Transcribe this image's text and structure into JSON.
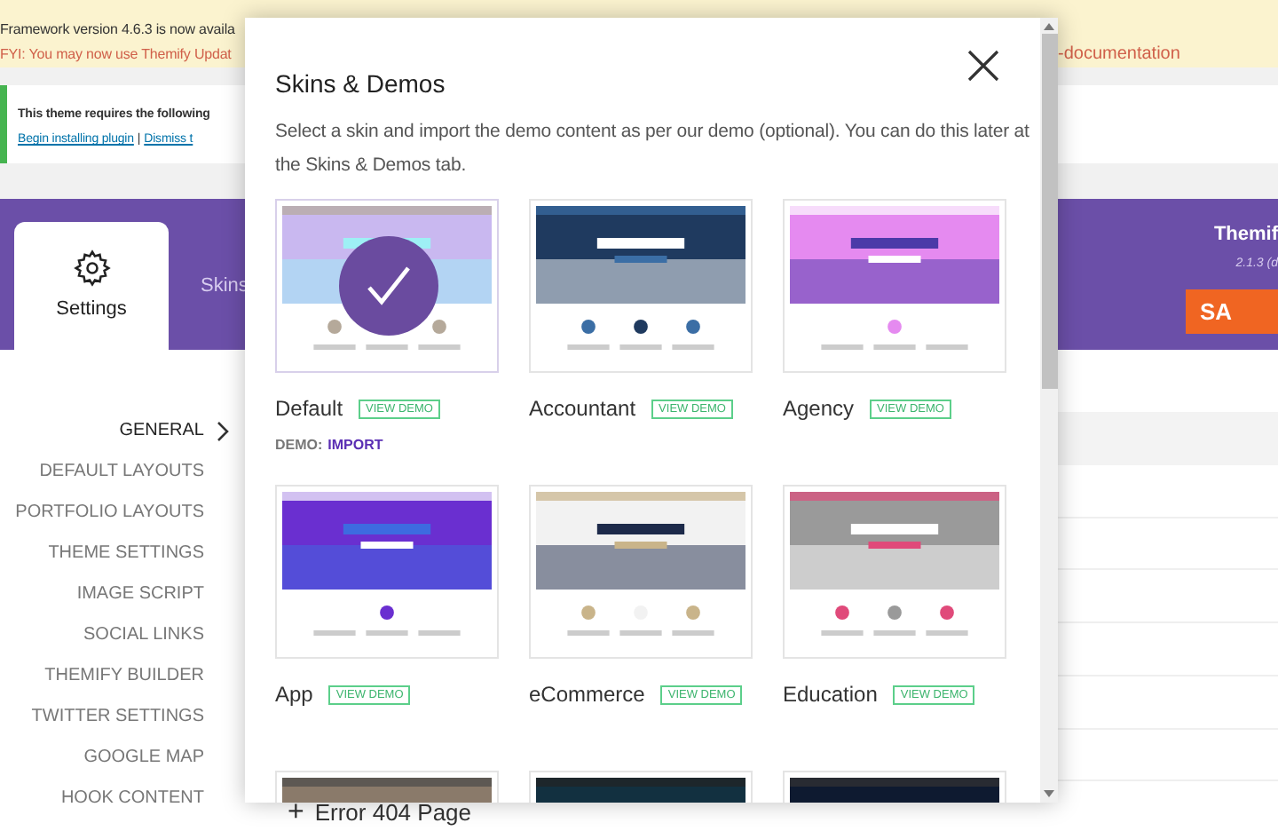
{
  "update_notice": {
    "line_1": "Framework version 4.6.3 is now availa",
    "line_2": "FYI: You may now use Themify Updat",
    "line_2_end": "-documentation"
  },
  "plugin_notice": {
    "text": "This theme requires the following",
    "link_1": "Begin installing plugin",
    "separator": "|",
    "link_2": "Dismiss t"
  },
  "header": {
    "tabs": [
      {
        "label": "Settings",
        "selected": true
      },
      {
        "label": "Skins",
        "selected": false
      }
    ],
    "product": "Themif",
    "version": "2.1.3 (d",
    "save_button": "SA"
  },
  "menu": [
    {
      "label": "GENERAL",
      "selected": true
    },
    {
      "label": "DEFAULT LAYOUTS",
      "selected": false
    },
    {
      "label": "PORTFOLIO LAYOUTS",
      "selected": false
    },
    {
      "label": "THEME SETTINGS",
      "selected": false
    },
    {
      "label": "IMAGE SCRIPT",
      "selected": false
    },
    {
      "label": "SOCIAL LINKS",
      "selected": false
    },
    {
      "label": "THEMIFY BUILDER",
      "selected": false
    },
    {
      "label": "TWITTER SETTINGS",
      "selected": false
    },
    {
      "label": "GOOGLE MAP",
      "selected": false
    },
    {
      "label": "HOOK CONTENT",
      "selected": false
    }
  ],
  "add_row": {
    "icon": "+",
    "label": "Error 404 Page"
  },
  "modal": {
    "title": "Skins & Demos",
    "description": "Select a skin and import the demo content as per our demo (optional). You can do this later at the Skins & Demos tab.",
    "skins": [
      {
        "name": "Default",
        "button": "VIEW DEMO",
        "selected": true,
        "demo_label": "DEMO:",
        "demo_action": "IMPORT"
      },
      {
        "name": "Accountant",
        "button": "VIEW DEMO",
        "selected": false
      },
      {
        "name": "Agency",
        "button": "VIEW DEMO",
        "selected": false
      },
      {
        "name": "App",
        "button": "VIEW DEMO",
        "selected": false
      },
      {
        "name": "eCommerce",
        "button": "VIEW DEMO",
        "selected": false
      },
      {
        "name": "Education",
        "button": "VIEW DEMO",
        "selected": false
      },
      {
        "selected": false
      },
      {
        "selected": false
      },
      {
        "selected": false
      }
    ]
  }
}
